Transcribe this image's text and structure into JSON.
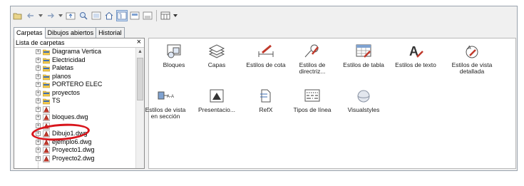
{
  "tabs": [
    {
      "label": "Carpetas",
      "selected": true
    },
    {
      "label": "Dibujos abiertos",
      "selected": false
    },
    {
      "label": "Historial",
      "selected": false
    }
  ],
  "left_panel": {
    "title": "Lista de carpetas",
    "close": "×",
    "tree": [
      {
        "label": "Diagrama Vertica",
        "icon": "folder-icon",
        "expander": "+"
      },
      {
        "label": "Electricidad",
        "icon": "folder-icon",
        "expander": "+"
      },
      {
        "label": "Paletas",
        "icon": "folder-icon",
        "expander": "+"
      },
      {
        "label": "planos",
        "icon": "folder-icon",
        "expander": "+"
      },
      {
        "label": "PORTERO ELEC",
        "icon": "folder-icon",
        "expander": "+"
      },
      {
        "label": "proyectos",
        "icon": "folder-icon",
        "expander": "+"
      },
      {
        "label": "TS",
        "icon": "folder-icon",
        "expander": "+"
      },
      {
        "label": "",
        "icon": "dwg-file-icon",
        "expander": "+"
      },
      {
        "label": "bloques.dwg",
        "icon": "dwg-file-icon",
        "expander": "+"
      },
      {
        "label": "",
        "icon": "dwg-file-icon",
        "expander": "+"
      },
      {
        "label": "Dibujo1.dwg",
        "icon": "dwg-file-icon",
        "expander": "+"
      },
      {
        "label": "ejemplo6.dwg",
        "icon": "dwg-file-icon",
        "expander": "+"
      },
      {
        "label": "Proyecto1.dwg",
        "icon": "dwg-file-icon",
        "expander": "+"
      },
      {
        "label": "Proyecto2.dwg",
        "icon": "dwg-file-icon",
        "expander": "+"
      }
    ]
  },
  "content_items": [
    {
      "label": "Bloques",
      "icon": "blocks-icon"
    },
    {
      "label": "Capas",
      "icon": "layers-icon"
    },
    {
      "label": "Estilos de cota",
      "icon": "dimension-style-icon"
    },
    {
      "label": "Estilos de directriz...",
      "icon": "multileader-style-icon"
    },
    {
      "label": "Estilos de tabla",
      "icon": "table-style-icon"
    },
    {
      "label": "Estilos de texto",
      "icon": "text-style-icon"
    },
    {
      "label": "Estilos de vista detallada",
      "icon": "detail-view-style-icon"
    },
    {
      "label": "Estilos de vista en sección",
      "icon": "section-view-style-icon"
    },
    {
      "label": "Presentacio...",
      "icon": "layout-icon"
    },
    {
      "label": "RefX",
      "icon": "xref-icon"
    },
    {
      "label": "Tipos de línea",
      "icon": "linetypes-icon"
    },
    {
      "label": "Visualstyles",
      "icon": "visual-styles-icon"
    }
  ],
  "colors": {
    "highlight": "#d8151c",
    "folder": "#f2c94c",
    "dwg": "#c0392b",
    "accent": "#3d6fb6"
  }
}
